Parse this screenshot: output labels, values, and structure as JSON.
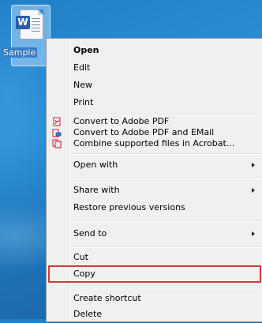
{
  "desktop": {
    "icon_name": "word-document-icon",
    "icon_letter": "W",
    "file_label": "Sample"
  },
  "menu": {
    "items": [
      {
        "label": "Open",
        "bold": true
      },
      {
        "label": "Edit"
      },
      {
        "label": "New"
      },
      {
        "label": "Print"
      },
      {
        "label": "Convert to Adobe PDF",
        "icon": "pdf-convert-icon"
      },
      {
        "label": "Convert to Adobe PDF and EMail",
        "icon": "pdf-email-icon"
      },
      {
        "label": "Combine supported files in Acrobat...",
        "icon": "acrobat-combine-icon"
      },
      {
        "label": "Open with",
        "submenu": true
      },
      {
        "label": "Share with",
        "submenu": true
      },
      {
        "label": "Restore previous versions"
      },
      {
        "label": "Send to",
        "submenu": true
      },
      {
        "label": "Cut"
      },
      {
        "label": "Copy",
        "highlighted": true
      },
      {
        "label": "Create shortcut"
      },
      {
        "label": "Delete"
      }
    ],
    "highlight_color": "#d43a3a",
    "pdf_icon_color": "#c8102e"
  }
}
